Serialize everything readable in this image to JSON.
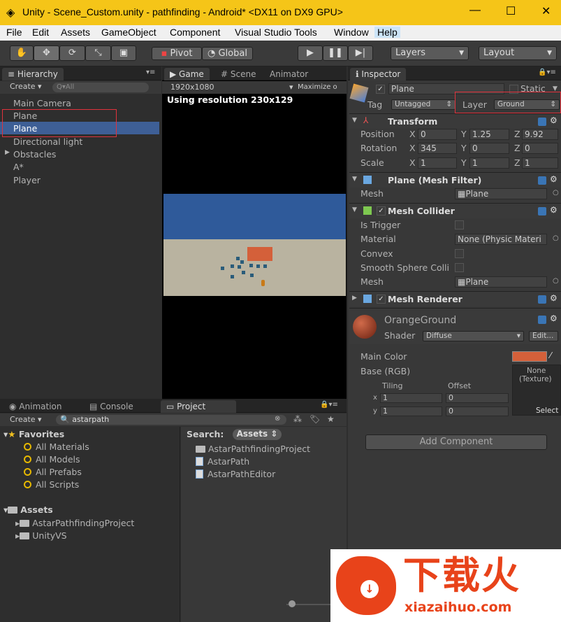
{
  "window": {
    "title": "Unity - Scene_Custom.unity - pathfinding - Android* <DX11 on DX9 GPU>",
    "min": "—",
    "max": "☐",
    "close": "✕"
  },
  "menu": [
    "File",
    "Edit",
    "Assets",
    "GameObject",
    "Component",
    "Visual Studio Tools",
    "Window",
    "Help"
  ],
  "toolbar": {
    "pivot": "Pivot",
    "global": "Global",
    "layers": "Layers",
    "layout": "Layout"
  },
  "hierarchy": {
    "tab": "Hierarchy",
    "create": "Create",
    "search_placeholder": "Q▾All",
    "items": [
      "Main Camera",
      "Plane",
      "Plane",
      "Directional light",
      "Obstacles",
      "A*",
      "Player"
    ]
  },
  "game": {
    "tabs": [
      "Game",
      "Scene",
      "Animator"
    ],
    "resolution": "1920x1080",
    "maximize": "Maximize o",
    "info": "Using resolution 230x129"
  },
  "inspector": {
    "tab": "Inspector",
    "object_name": "Plane",
    "static_label": "Static",
    "tag_label": "Tag",
    "tag_value": "Untagged",
    "layer_label": "Layer",
    "layer_value": "Ground",
    "transform": {
      "name": "Transform",
      "position_label": "Position",
      "rotation_label": "Rotation",
      "scale_label": "Scale",
      "position": [
        "0",
        "1.25",
        "9.92"
      ],
      "rotation": [
        "345",
        "0",
        "0"
      ],
      "scale": [
        "1",
        "1",
        "1"
      ]
    },
    "mesh_filter": {
      "name": "Plane (Mesh Filter)",
      "mesh_label": "Mesh",
      "mesh_value": "Plane"
    },
    "mesh_collider": {
      "name": "Mesh Collider",
      "is_trigger": "Is Trigger",
      "material": "Material",
      "material_value": "None (Physic Materi",
      "convex": "Convex",
      "smooth": "Smooth Sphere Colli",
      "mesh": "Mesh",
      "mesh_value": "Plane"
    },
    "mesh_renderer": {
      "name": "Mesh Renderer"
    },
    "material": {
      "name": "OrangeGround",
      "shader_label": "Shader",
      "shader_value": "Diffuse",
      "edit": "Edit...",
      "main_color": "Main Color",
      "base": "Base (RGB)",
      "tiling": "Tiling",
      "offset": "Offset",
      "tex_none": "None",
      "tex_type": "(Texture)",
      "select": "Select",
      "x": "x",
      "y": "y",
      "tile_x": "1",
      "tile_y": "1",
      "off_x": "0",
      "off_y": "0",
      "color": "#d4603a"
    },
    "add_component": "Add Component"
  },
  "bottom": {
    "tabs": [
      "Animation",
      "Console",
      "Project"
    ],
    "create": "Create",
    "search": "astarpath",
    "favorites": "Favorites",
    "fav_items": [
      "All Materials",
      "All Models",
      "All Prefabs",
      "All Scripts"
    ],
    "assets": "Assets",
    "asset_items": [
      "AstarPathfindingProject",
      "UnityVS"
    ],
    "search_label": "Search:",
    "search_scope": "Assets",
    "results": [
      "AstarPathfindingProject",
      "AstarPath",
      "AstarPathEditor"
    ]
  },
  "watermark": {
    "text": "下载火",
    "url": "xiazaihuo.com"
  }
}
